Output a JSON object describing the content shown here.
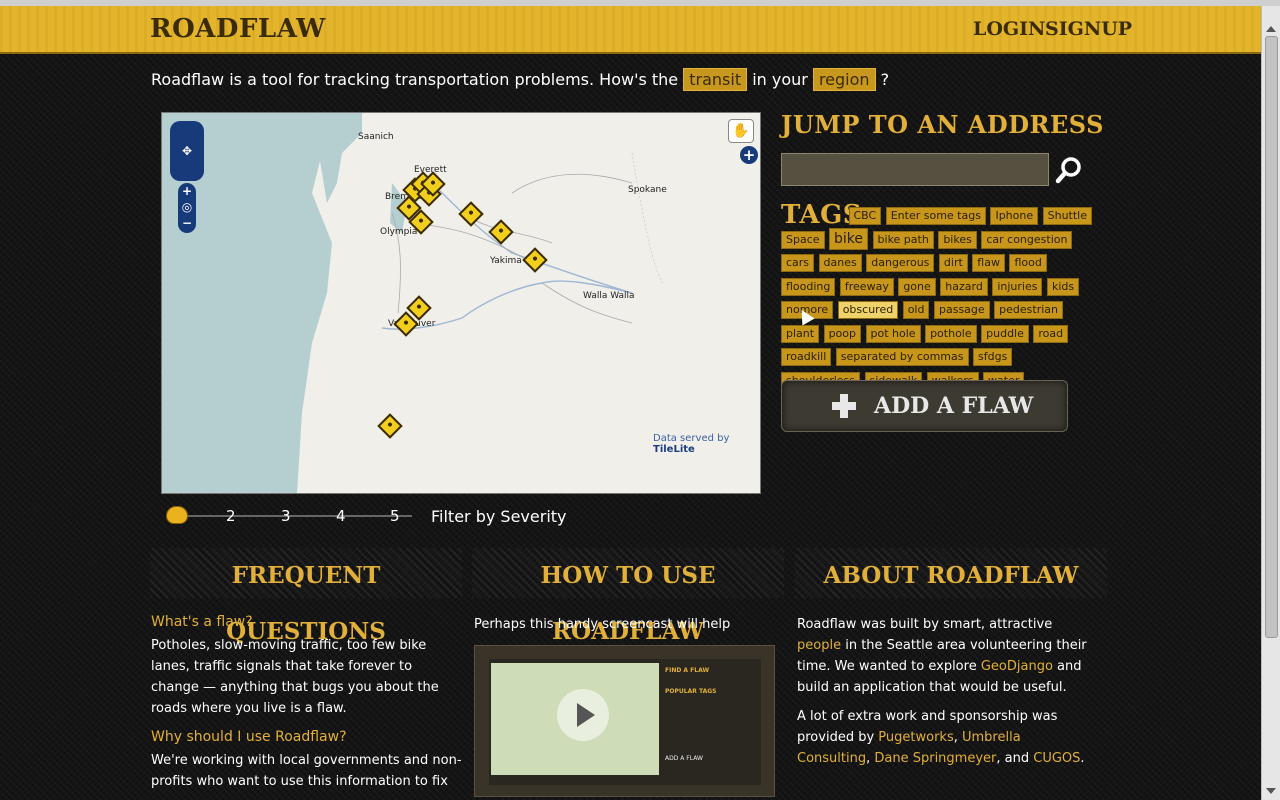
{
  "header": {
    "logo": "ROADFLAW",
    "login": "LOGIN",
    "signup": "SIGNUP"
  },
  "intro": {
    "text_before": "Roadflaw is a tool for tracking transportation problems. How's the",
    "chip_transit": "transit",
    "text_middle": "in your",
    "chip_region": "region",
    "text_after": "?"
  },
  "map": {
    "cities": [
      "Saanich",
      "Everett",
      "Bremerton",
      "Olympia",
      "Spokane",
      "Yakima",
      "Walla Walla",
      "Vancouver"
    ],
    "credit_prefix": "Data served by",
    "credit_link": "TileLite",
    "pin_count": 14
  },
  "severity": {
    "ticks": [
      "2",
      "3",
      "4",
      "5"
    ],
    "selected": 1,
    "label": "Filter by Severity"
  },
  "jump": {
    "title": "JUMP TO AN ADDRESS",
    "placeholder": ""
  },
  "tags": {
    "title": "TAGS",
    "items": [
      "CBC",
      "Enter some tags",
      "Iphone",
      "Shuttle",
      "Space",
      "bike",
      "bike path",
      "bikes",
      "car congestion",
      "cars",
      "danes",
      "dangerous",
      "dirt",
      "flaw",
      "flood",
      "flooding",
      "freeway",
      "gone",
      "hazard",
      "injuries",
      "kids",
      "nomore",
      "obscured",
      "old",
      "passage",
      "pedestrian",
      "plant",
      "poop",
      "pot hole",
      "pothole",
      "puddle",
      "road",
      "roadkill",
      "separated by commas",
      "sfdgs",
      "shoulderless",
      "sidewalk",
      "walkers",
      "water"
    ],
    "big": "bike",
    "active": "obscured"
  },
  "add_flaw": {
    "label": "ADD A FLAW"
  },
  "faq": {
    "title": "FREQUENT QUESTIONS",
    "q1": "What's a flaw?",
    "a1": "Potholes, slow-moving traffic, too few bike lanes, traffic signals that take forever to change — anything that bugs you about the roads where you live is a flaw.",
    "q2": "Why should I use Roadflaw?",
    "a2": "We're working with local governments and non-profits who want to use this information to fix"
  },
  "howto": {
    "title": "HOW TO USE ROADFLAW",
    "text": "Perhaps this handy screencast will help",
    "thumb_find": "FIND A FLAW",
    "thumb_popular": "POPULAR TAGS",
    "thumb_add": "ADD A FLAW"
  },
  "about": {
    "title": "ABOUT ROADFLAW",
    "p1_a": "Roadflaw was built by smart, attractive",
    "p1_link1": "people",
    "p1_b": "in the Seattle area volunteering their time. We wanted to explore",
    "p1_link2": "GeoDjango",
    "p1_c": "and build an application that would be useful.",
    "p2_a": "A lot of extra work and sponsorship was provided by",
    "link_pugetworks": "Pugetworks",
    "link_umbrella": "Umbrella Consulting",
    "link_dane": "Dane Springmeyer",
    "p2_and": ", and",
    "link_cugos": "CUGOS",
    "p2_end": "."
  }
}
